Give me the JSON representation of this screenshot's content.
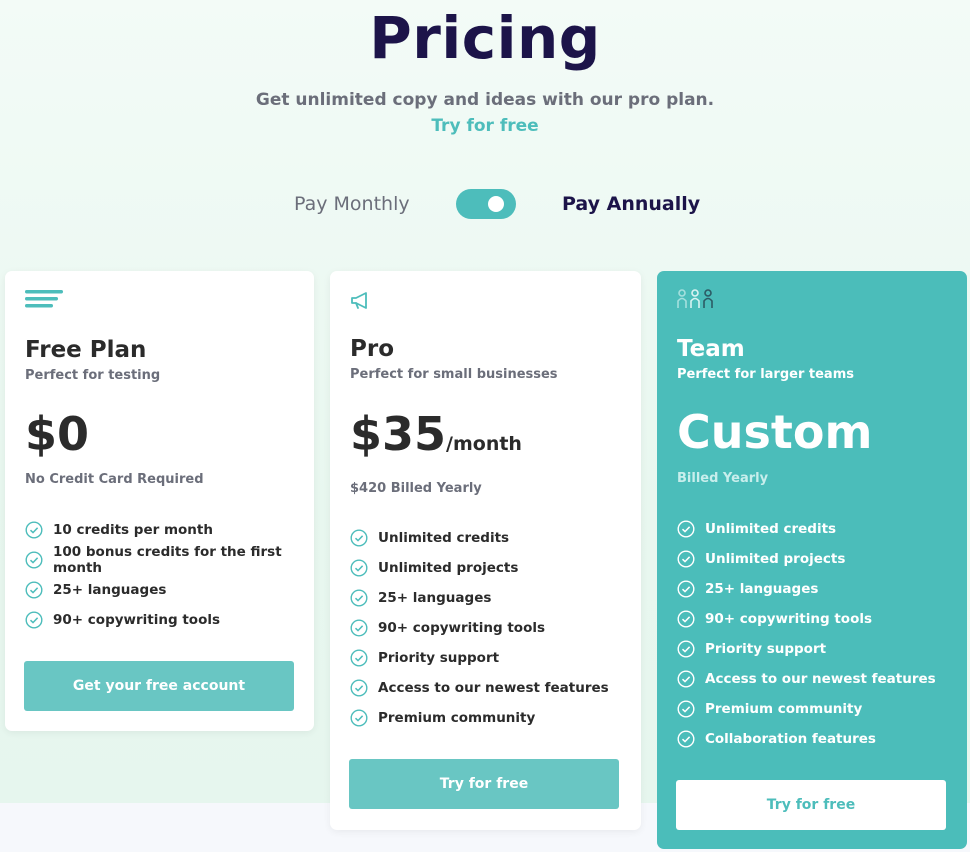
{
  "header": {
    "title": "Pricing",
    "subtitle": "Get unlimited copy and ideas with our pro plan.",
    "link": "Try for free"
  },
  "billing": {
    "monthly_label": "Pay Monthly",
    "annual_label": "Pay Annually",
    "annual_selected": true
  },
  "plans": [
    {
      "name": "Free Plan",
      "subtitle": "Perfect for testing",
      "price": "$0",
      "price_unit": "",
      "note": "No Credit Card Required",
      "features": [
        "10 credits per month",
        "100 bonus credits for the first month",
        "25+ languages",
        "90+ copywriting tools"
      ],
      "cta": "Get your free account",
      "icon": "menu-lines-icon"
    },
    {
      "name": "Pro",
      "subtitle": "Perfect for small businesses",
      "price": "$35",
      "price_unit": "/month",
      "note": "$420 Billed Yearly",
      "features": [
        "Unlimited credits",
        "Unlimited projects",
        "25+ languages",
        "90+ copywriting tools",
        "Priority support",
        "Access to our newest features",
        "Premium community"
      ],
      "cta": "Try for free",
      "icon": "megaphone-icon"
    },
    {
      "name": "Team",
      "subtitle": "Perfect for larger teams",
      "price": "Custom",
      "price_unit": "",
      "note": "Billed Yearly",
      "features": [
        "Unlimited credits",
        "Unlimited projects",
        "25+ languages",
        "90+ copywriting tools",
        "Priority support",
        "Access to our newest features",
        "Premium community",
        "Collaboration features"
      ],
      "cta": "Try for free",
      "icon": "team-people-icon"
    }
  ],
  "colors": {
    "title": "#1c1449",
    "accent": "#4dbdbb",
    "team_card": "#4bbdba",
    "button": "#69c6c3"
  }
}
